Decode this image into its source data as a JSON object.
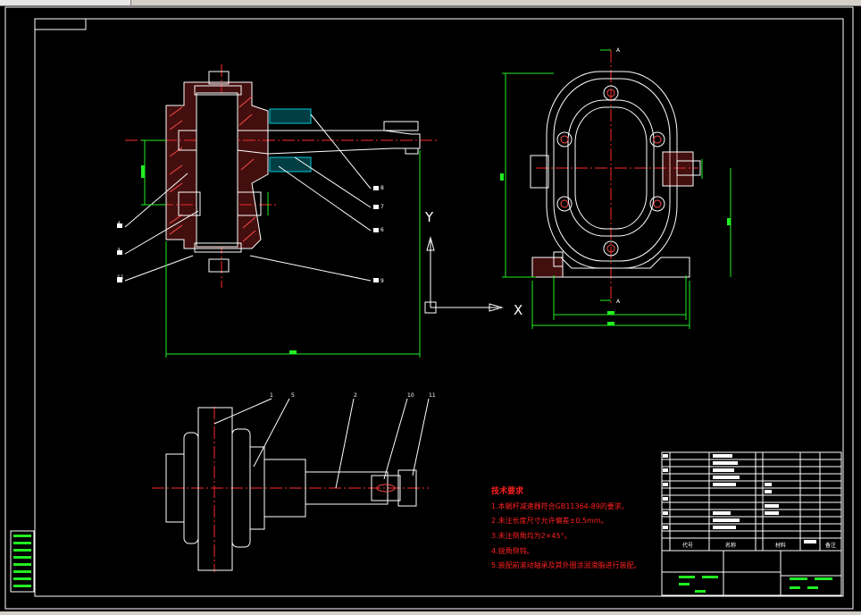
{
  "window": {
    "accent": "#d4d0c8",
    "canvas_bg": "#000000"
  },
  "colors": {
    "outline": "#ffffff",
    "hatch": "#ff4a4a",
    "center_line": "#ff2a2a",
    "dimension": "#22ee22",
    "cyan_part": "#00c8d8",
    "text_red": "#ff2020"
  },
  "axis": {
    "y_label": "Y",
    "x_label": "X"
  },
  "section_marks": {
    "top": "A",
    "bottom": "A"
  },
  "technical_requirements": {
    "title": "技术要求",
    "items": [
      "1.本蜗杆减速器符合GB11364-89的要求。",
      "2.未注长度尺寸允许偏差±0.5mm。",
      "3.未注倒角均为2×45°。",
      "4.锐角倒钝。",
      "5.装配前滚动轴承及其外圈涂润滑脂进行装配。"
    ]
  },
  "leader_labels": {
    "top_left": [
      "4",
      "3",
      "11"
    ],
    "top_right": [
      "8",
      "7",
      "6",
      "9"
    ],
    "bottom": [
      "1",
      "5",
      "2",
      "10",
      "11"
    ]
  },
  "title_block": {
    "headers": {
      "code": "代号",
      "name": "名称",
      "material": "材料",
      "remark": "备注"
    }
  }
}
